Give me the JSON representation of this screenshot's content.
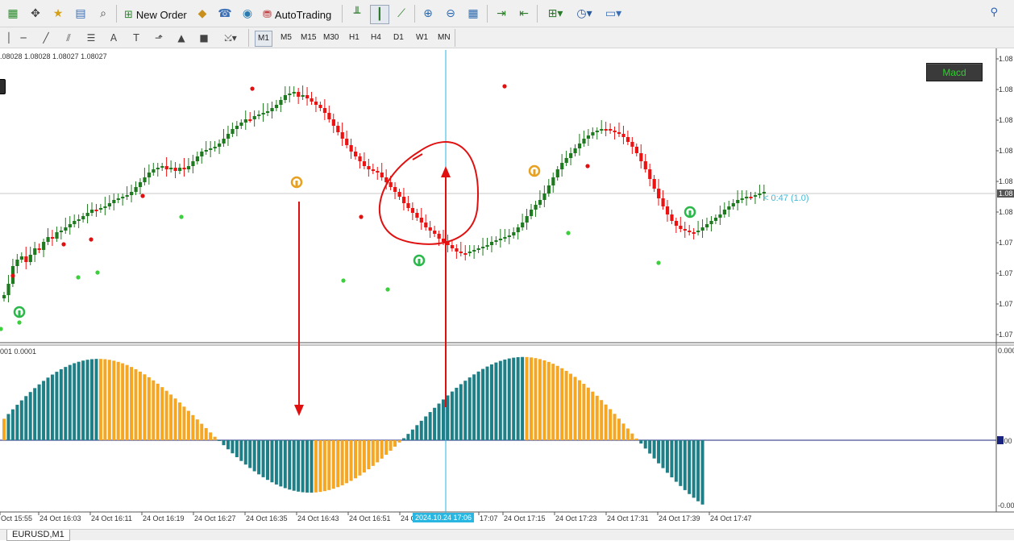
{
  "toolbar": {
    "new_order_label": "New Order",
    "autotrading_label": "AutoTrading",
    "timeframes": [
      "M1",
      "M5",
      "M15",
      "M30",
      "H1",
      "H4",
      "D1",
      "W1",
      "MN"
    ],
    "active_timeframe": "M1"
  },
  "chart": {
    "ohlc_text": ".08028 1.08028 1.08027 1.08027",
    "indicator_values_text": "001 0.0001",
    "macd_button_label": "Macd",
    "countdown_text": "< 0:47 (1.0)",
    "crosshair_time_label": "2024.10.24 17:06",
    "price_axis_labels": [
      "1.08",
      "1.08",
      "1.08",
      "1.08",
      "1.08",
      "1.08",
      "1.07",
      "1.07",
      "1.07",
      "1.07"
    ],
    "current_price_tag": "1.08",
    "macd_axis_labels": [
      "0.000",
      "0.00",
      "-0.00"
    ],
    "macd_zero_tag": "0.00",
    "time_labels": [
      "Oct 15:55",
      "24 Oct 16:03",
      "24 Oct 16:11",
      "24 Oct 16:19",
      "24 Oct 16:27",
      "24 Oct 16:35",
      "24 Oct 16:43",
      "24 Oct 16:51",
      "24 O",
      "17:07",
      "24 Oct 17:15",
      "24 Oct 17:23",
      "24 Oct 17:31",
      "24 Oct 17:39",
      "24 Oct 17:47"
    ]
  },
  "tabs": {
    "symbol_tab": "EURUSD,M1"
  },
  "colors": {
    "bull": "#1e7a1e",
    "bear": "#ee1111",
    "macd_teal": "#1f7f86",
    "macd_orange": "#f5a623",
    "crosshair": "#29b6e0",
    "annotation_red": "#e01010",
    "dot_green": "#3ccf3c",
    "dot_red": "#e01010"
  }
}
